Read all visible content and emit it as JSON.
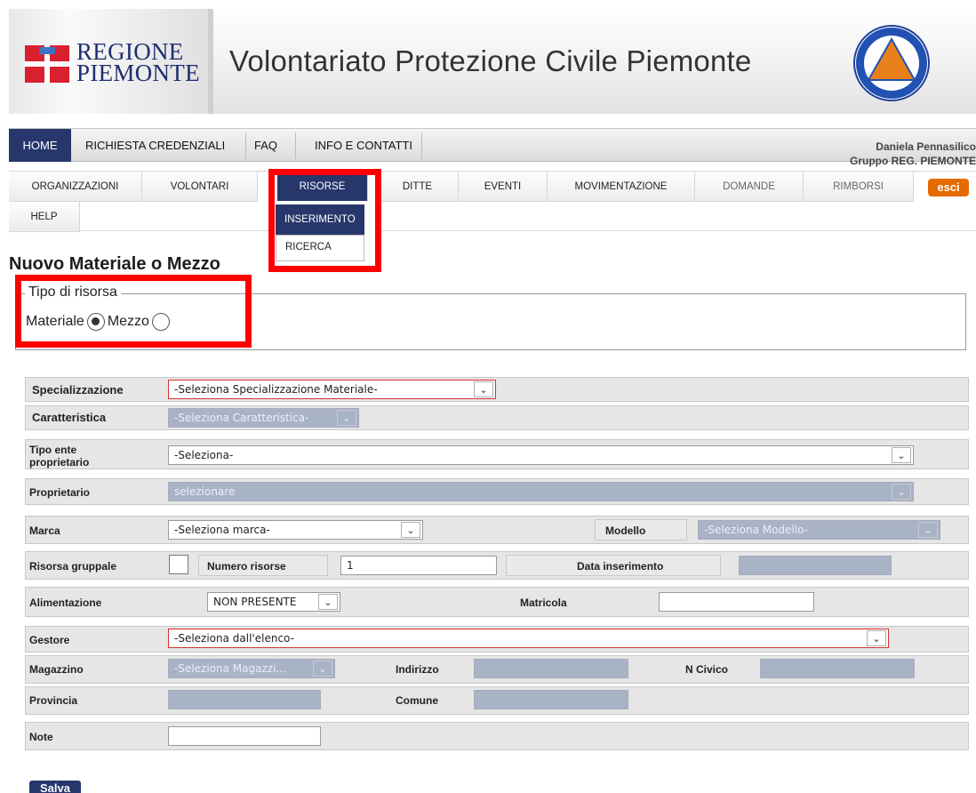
{
  "header": {
    "logo_line1": "REGIONE",
    "logo_line2": "PIEMONTE",
    "title": "Volontariato Protezione Civile Piemonte",
    "pc_logo_top": "PROTEZIONE CIVILE",
    "pc_logo_bottom": "REGIONE PIEMONTE"
  },
  "nav_main": {
    "items": [
      "HOME",
      "RICHIESTA CREDENZIALI",
      "FAQ",
      "INFO E CONTATTI"
    ],
    "user_name": "Daniela Pennasilico",
    "user_group": "Gruppo REG. PIEMONTE"
  },
  "nav_sub": {
    "items": [
      "ORGANIZZAZIONI",
      "VOLONTARI",
      "RISORSE",
      "DITTE",
      "EVENTI",
      "MOVIMENTAZIONE",
      "DOMANDE",
      "RIMBORSI"
    ],
    "help": "HELP",
    "logout": "esci",
    "dropdown": [
      "INSERIMENTO",
      "RICERCA"
    ]
  },
  "page": {
    "heading": "Nuovo Materiale o Mezzo",
    "resource_type": {
      "legend": "Tipo di risorsa",
      "option1": "Materiale",
      "option2": "Mezzo",
      "selected": "Materiale"
    }
  },
  "form": {
    "specializzazione": {
      "label": "Specializzazione",
      "value": "-Seleziona Specializzazione Materiale-"
    },
    "caratteristica": {
      "label": "Caratteristica",
      "value": "-Seleziona Caratteristica-"
    },
    "tipo_ente": {
      "label_line1": "Tipo ente",
      "label_line2": "proprietario",
      "value": "-Seleziona-"
    },
    "proprietario": {
      "label": "Proprietario",
      "value": "selezionare"
    },
    "marca": {
      "label": "Marca",
      "value": "-Seleziona marca-"
    },
    "modello": {
      "label": "Modello",
      "value": "-Seleziona Modello-"
    },
    "risorsa_gruppale": {
      "label": "Risorsa gruppale"
    },
    "numero_risorse": {
      "label": "Numero risorse",
      "value": "1"
    },
    "data_inserimento": {
      "label": "Data inserimento",
      "value": ""
    },
    "alimentazione": {
      "label": "Alimentazione",
      "value": "NON PRESENTE"
    },
    "matricola": {
      "label": "Matricola",
      "value": ""
    },
    "gestore": {
      "label": "Gestore",
      "value": "-Seleziona dall'elenco-"
    },
    "magazzino": {
      "label": "Magazzino",
      "value": "-Seleziona Magazzi..."
    },
    "indirizzo": {
      "label": "Indirizzo",
      "value": ""
    },
    "n_civico": {
      "label": "N Civico",
      "value": ""
    },
    "provincia": {
      "label": "Provincia",
      "value": ""
    },
    "comune": {
      "label": "Comune",
      "value": ""
    },
    "note": {
      "label": "Note",
      "value": ""
    },
    "save_label": "Salva"
  },
  "colors": {
    "nav_active": "#27376b",
    "highlight": "#ff0000",
    "logout": "#e56a00",
    "disabled_field": "#a8b3c6"
  }
}
